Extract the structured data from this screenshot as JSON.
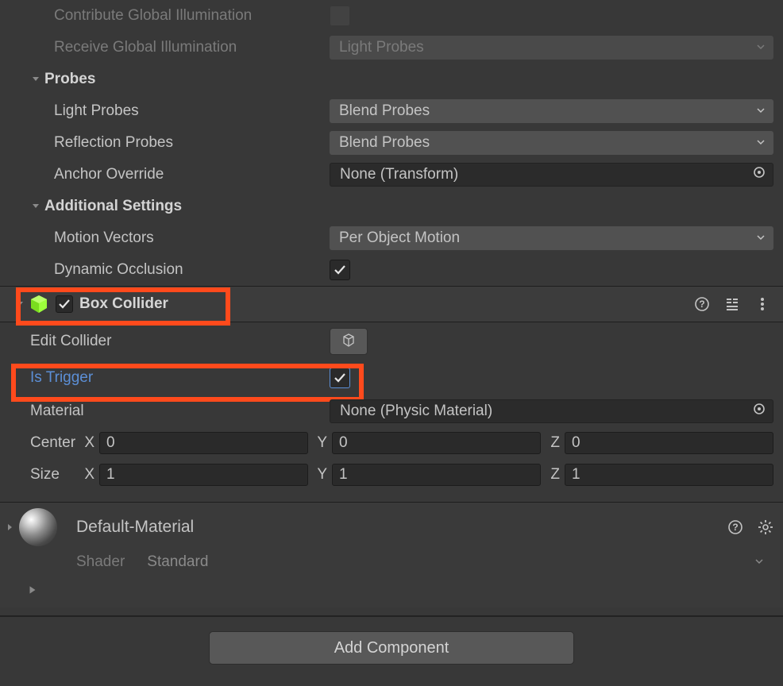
{
  "mesh_renderer": {
    "contribute_gi": "Contribute Global Illumination",
    "contribute_gi_checked": false,
    "receive_gi_label": "Receive Global Illumination",
    "receive_gi_value": "Light Probes",
    "probes_header": "Probes",
    "light_probes_label": "Light Probes",
    "light_probes_value": "Blend Probes",
    "reflection_probes_label": "Reflection Probes",
    "reflection_probes_value": "Blend Probes",
    "anchor_override_label": "Anchor Override",
    "anchor_override_value": "None (Transform)",
    "additional_header": "Additional Settings",
    "motion_vectors_label": "Motion Vectors",
    "motion_vectors_value": "Per Object Motion",
    "dynamic_occlusion_label": "Dynamic Occlusion",
    "dynamic_occlusion_checked": true
  },
  "box_collider": {
    "title": "Box Collider",
    "enabled": true,
    "edit_collider_label": "Edit Collider",
    "is_trigger_label": "Is Trigger",
    "is_trigger_checked": true,
    "material_label": "Material",
    "material_value": "None (Physic Material)",
    "center_label": "Center",
    "center": {
      "x": "0",
      "y": "0",
      "z": "0"
    },
    "size_label": "Size",
    "size": {
      "x": "1",
      "y": "1",
      "z": "1"
    },
    "axis": {
      "x": "X",
      "y": "Y",
      "z": "Z"
    }
  },
  "material_panel": {
    "name": "Default-Material",
    "shader_label": "Shader",
    "shader_value": "Standard"
  },
  "footer": {
    "add_component": "Add Component"
  }
}
